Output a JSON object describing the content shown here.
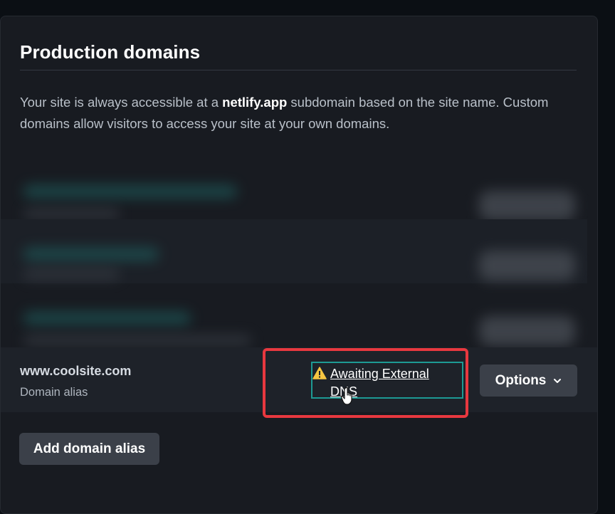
{
  "section": {
    "title": "Production domains",
    "description_parts": {
      "before": "Your site is always accessible at a ",
      "bold": "netlify.app",
      "after": " subdomain based on the site name. Custom domains allow visitors to access your site at your own domains."
    }
  },
  "domain_row": {
    "domain": "www.coolsite.com",
    "type": "Domain alias",
    "status_link": "Awaiting External DNS",
    "status_icon": "warning-icon",
    "options_label": "Options",
    "options_icon": "chevron-down-icon"
  },
  "actions": {
    "add_alias_label": "Add domain alias"
  },
  "colors": {
    "warning": "#f5c542",
    "highlight_teal": "#1d9a94",
    "annotation_red": "#e8383f",
    "button_bg": "#3b4049"
  }
}
